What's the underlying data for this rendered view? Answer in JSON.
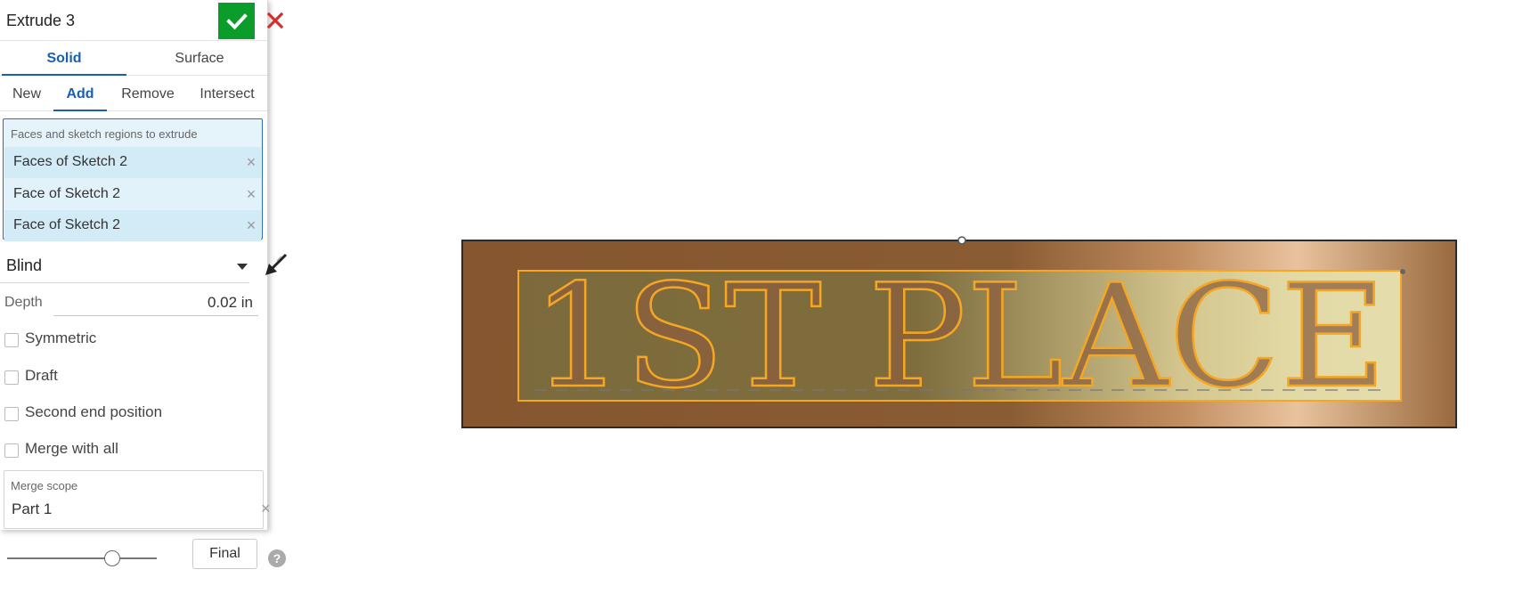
{
  "panel": {
    "title": "Extrude 3",
    "kind_tabs": [
      {
        "label": "Solid",
        "active": true
      },
      {
        "label": "Surface",
        "active": false
      }
    ],
    "operation_tabs": [
      {
        "label": "New",
        "active": false
      },
      {
        "label": "Add",
        "active": true
      },
      {
        "label": "Remove",
        "active": false
      },
      {
        "label": "Intersect",
        "active": false
      }
    ],
    "faces": {
      "label": "Faces and sketch regions to extrude",
      "items": [
        "Faces of Sketch 2",
        "Face of Sketch 2",
        "Face of Sketch 2"
      ]
    },
    "end_type": "Blind",
    "depth": {
      "label": "Depth",
      "value": "0.02 in"
    },
    "options": [
      {
        "label": "Symmetric",
        "checked": false
      },
      {
        "label": "Draft",
        "checked": false
      },
      {
        "label": "Second end position",
        "checked": false
      },
      {
        "label": "Merge with all",
        "checked": false
      }
    ],
    "merge_scope": {
      "label": "Merge scope",
      "items": [
        "Part 1"
      ]
    },
    "final_label": "Final",
    "help_glyph": "?",
    "remove_glyph": "×"
  },
  "viewport": {
    "plaque_text": "1ST PLACE"
  },
  "colors": {
    "accept": "#0a9d2a",
    "cancel": "#d32f2f",
    "accent": "#1a5fb4",
    "selection_bg": "#d2ebf7",
    "plaque_base": "#8a5a32",
    "highlight": "#f5a623"
  }
}
